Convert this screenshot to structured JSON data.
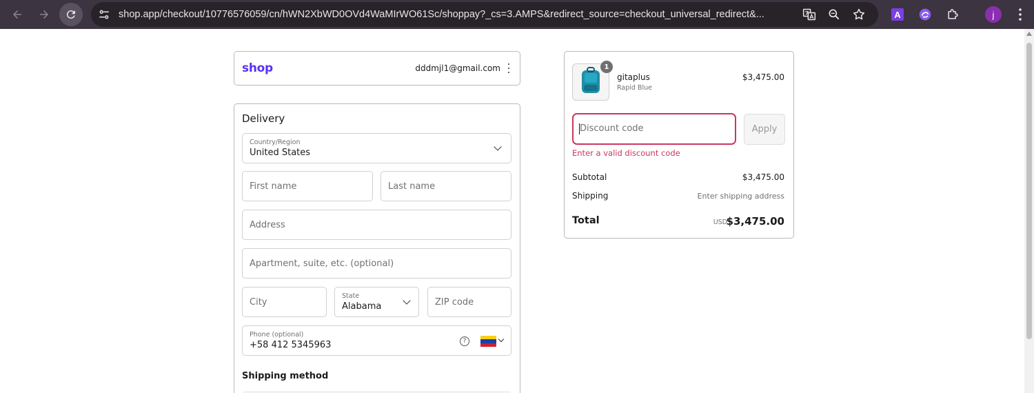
{
  "browser": {
    "url": "shop.app/checkout/10776576059/cn/hWN2XbWD0OVd4WaMIrWO61Sc/shoppay?_cs=3.AMPS&redirect_source=checkout_universal_redirect&...",
    "profile_initial": "j",
    "extension_a_label": "A"
  },
  "shop_header": {
    "logo": "shop",
    "email": "dddmjl1@gmail.com"
  },
  "delivery": {
    "title": "Delivery",
    "country_label": "Country/Region",
    "country_value": "United States",
    "first_name_placeholder": "First name",
    "last_name_placeholder": "Last name",
    "address_placeholder": "Address",
    "apartment_placeholder": "Apartment, suite, etc. (optional)",
    "city_placeholder": "City",
    "state_label": "State",
    "state_value": "Alabama",
    "zip_placeholder": "ZIP code",
    "phone_label": "Phone (optional)",
    "phone_value": "+58 412 5345963",
    "help_glyph": "?",
    "shipping_method_title": "Shipping method"
  },
  "order_summary": {
    "item": {
      "quantity_badge": "1",
      "name": "gitaplus",
      "variant": "Rapid Blue",
      "price": "$3,475.00"
    },
    "discount_placeholder": "Discount code",
    "apply_label": "Apply",
    "discount_error": "Enter a valid discount code",
    "subtotal_label": "Subtotal",
    "subtotal_value": "$3,475.00",
    "shipping_label": "Shipping",
    "shipping_value": "Enter shipping address",
    "total_label": "Total",
    "total_currency": "USD",
    "total_value": "$3,475.00"
  },
  "colors": {
    "shop_brand": "#5a31f4",
    "error": "#c9375e",
    "chrome_bg": "#3c3440"
  }
}
